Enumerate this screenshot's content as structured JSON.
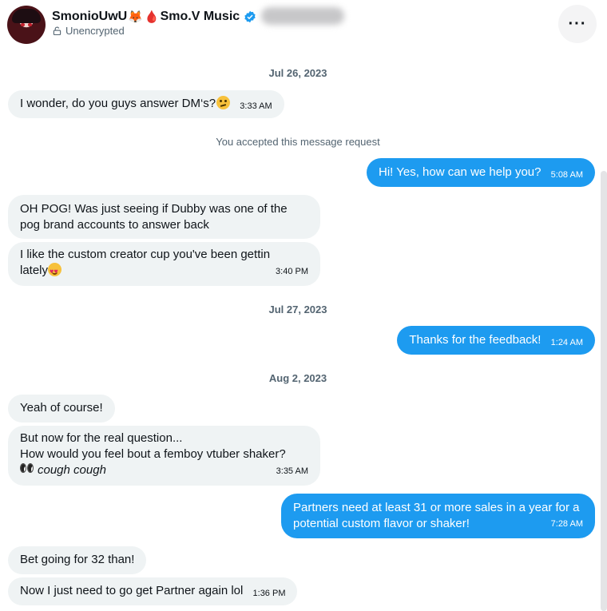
{
  "header": {
    "name": "SmonioUwU",
    "fox_emoji": "🦊",
    "drop_emoji": "🩸",
    "name_suffix": "Smo.V Music",
    "encryption": "Unencrypted",
    "more_label": "···",
    "verified_icon": "verified-badge-icon",
    "lock_icon": "unlock-icon"
  },
  "colors": {
    "accent": "#1d9bf0",
    "incoming_bubble": "#eff3f4",
    "secondary_text": "#536471"
  },
  "conversation": {
    "date1": "Jul 26, 2023",
    "msg1": {
      "text": "I wonder, do you guys answer DM‘s?",
      "time": "3:33 AM",
      "emoji": "thinking-face"
    },
    "system1": "You accepted this message request",
    "msg2": {
      "text": "Hi! Yes, how can we help you?",
      "time": "5:08 AM"
    },
    "msg3": {
      "line1": "OH POG!  Was just seeing if Dubby was one of the",
      "line2": "pog brand accounts to answer back"
    },
    "msg4": {
      "line1": "I like the custom creator cup you've been gettin",
      "line2": "lately",
      "time": "3:40 PM",
      "emoji": "smiling-face-with-heart-eyes"
    },
    "date2": "Jul 27, 2023",
    "msg5": {
      "text": "Thanks for the feedback!",
      "time": "1:24 AM"
    },
    "date3": "Aug 2, 2023",
    "msg6": {
      "text": "Yeah of course!"
    },
    "msg7": {
      "line1": "But now for the real question...",
      "line2": "How would you feel bout a femboy vtuber shaker?",
      "line3": "cough cough",
      "time": "3:35 AM",
      "emoji": "eyes"
    },
    "msg8": {
      "line1": "Partners need at least 31 or more sales in a year for a",
      "line2": "potential custom flavor or shaker!",
      "time": "7:28 AM"
    },
    "msg9": {
      "text": "Bet going for 32 than!"
    },
    "msg10": {
      "text": "Now I just need to go get Partner again lol",
      "time": "1:36 PM"
    }
  }
}
